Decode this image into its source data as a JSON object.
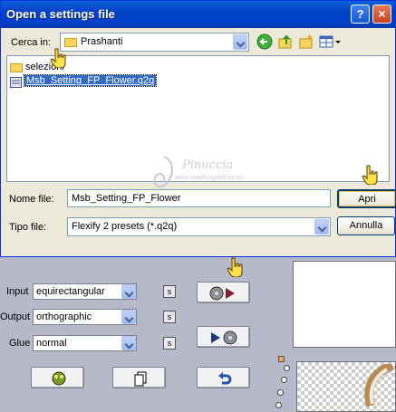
{
  "dialog": {
    "title": "Open a settings file",
    "help_label": "?",
    "close_label": "×",
    "look_in_label": "Cerca in:",
    "look_in_value": "Prashanti",
    "items": [
      {
        "name": "selezioni",
        "type": "folder"
      },
      {
        "name": "Msb_Setting_FP_Flower.q2q",
        "type": "file",
        "selected": true
      }
    ],
    "filename_label": "Nome file:",
    "filename_value": "Msb_Setting_FP_Flower",
    "filetype_label": "Tipo file:",
    "filetype_value": "Flexify 2 presets (*.q2q)",
    "open_label": "Apri",
    "cancel_label": "Annulla"
  },
  "watermark": {
    "name": "Pinuccia",
    "site": "www.maldrasgraficaz.eu"
  },
  "plugin": {
    "input_label": "Input",
    "input_value": "equirectangular",
    "output_label": "Output",
    "output_value": "orthographic",
    "glue_label": "Glue",
    "glue_value": "normal",
    "s_label": "s"
  },
  "colors": {
    "title_bar": "#0a5fd8",
    "dialog_bg": "#ece9d8",
    "selection": "#316ac5",
    "panel_bg": "#b6b9c9"
  }
}
